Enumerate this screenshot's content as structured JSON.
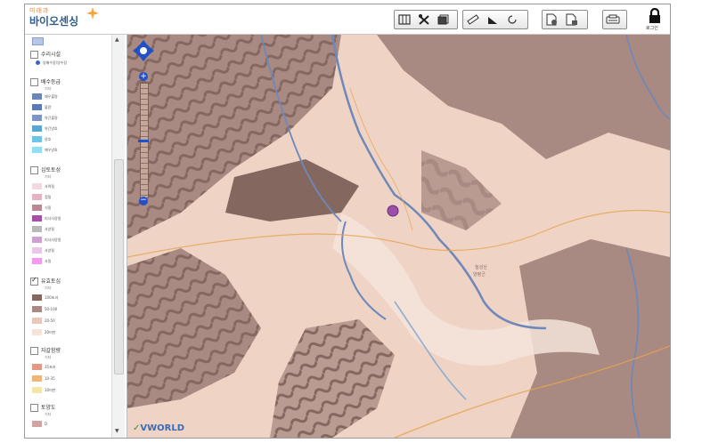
{
  "app": {
    "logo_small": "미래과",
    "logo_main": "바이오센싱",
    "login_label": "로그인"
  },
  "toolbar": {
    "icons": [
      "map-icon",
      "tools-icon",
      "layers-icon",
      "ruler-icon",
      "area-icon",
      "circle-icon",
      "export-icon",
      "export2-icon",
      "print-icon",
      "lock-icon"
    ]
  },
  "sidebar": {
    "layers": [
      {
        "label": "수리시설",
        "checked": false,
        "sub": "",
        "items": [
          {
            "label": "양배수장/양수장",
            "color": "#3a66c8"
          }
        ]
      },
      {
        "label": "배수등급",
        "checked": false,
        "sub": "기타",
        "items": [
          {
            "label": "매우불량",
            "color": "#6b86b8"
          },
          {
            "label": "불량",
            "color": "#5b79b6"
          },
          {
            "label": "약간불량",
            "color": "#7c95c6"
          },
          {
            "label": "약간양호",
            "color": "#55a8d6"
          },
          {
            "label": "양호",
            "color": "#6dc4e6"
          },
          {
            "label": "매우양호",
            "color": "#8fe0f2"
          }
        ]
      },
      {
        "label": "심토토성",
        "checked": false,
        "sub": "기타",
        "items": [
          {
            "label": "사력질",
            "color": "#f1d9df"
          },
          {
            "label": "점질",
            "color": "#e4b4c2"
          },
          {
            "label": "식질",
            "color": "#b98a94"
          },
          {
            "label": "미사식양질",
            "color": "#a54fa8"
          },
          {
            "label": "사양질",
            "color": "#b9b9b9"
          },
          {
            "label": "미사사양질",
            "color": "#cfa0cf"
          },
          {
            "label": "사양질",
            "color": "#e9c7e9"
          },
          {
            "label": "사질",
            "color": "#f39af0"
          }
        ]
      },
      {
        "label": "유효토심",
        "checked": true,
        "sub": "기타",
        "items": [
          {
            "label": "100초과",
            "color": "#84675f"
          },
          {
            "label": "50-100",
            "color": "#a88a82"
          },
          {
            "label": "20-50",
            "color": "#e8c8ba"
          },
          {
            "label": "20미만",
            "color": "#f5e3da"
          }
        ]
      },
      {
        "label": "자갈함량",
        "checked": false,
        "sub": "기타",
        "items": [
          {
            "label": "35초과",
            "color": "#e09a86"
          },
          {
            "label": "10-35",
            "color": "#f0b679"
          },
          {
            "label": "10미만",
            "color": "#f4e6a8"
          }
        ]
      },
      {
        "label": "토양도",
        "checked": false,
        "sub": "기타",
        "items": [
          {
            "label": "D",
            "color": "#d1a3a3"
          }
        ]
      }
    ]
  },
  "map": {
    "watermark": "VWORLD",
    "place_label_1": "칠성산",
    "place_label_2": "양평군",
    "colors": {
      "dark": "#84675f",
      "mid": "#a88a82",
      "light": "#e8c8ba",
      "bg": "#efd3c5",
      "water": "#6f88b8",
      "road": "#e7a24d"
    }
  }
}
